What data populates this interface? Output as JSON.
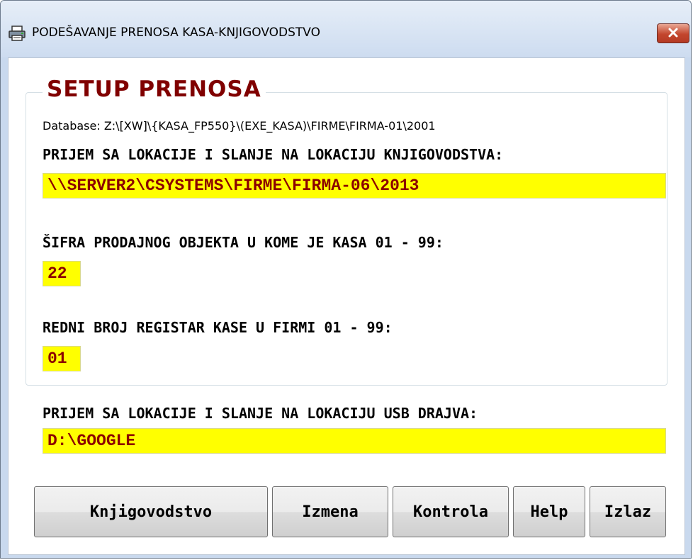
{
  "window": {
    "title": "PODEŠAVANJE PRENOSA KASA-KNJIGOVODSTVO",
    "close_label": "✕"
  },
  "setup": {
    "group_title": "SETUP PRENOSA",
    "database_line": "Database: Z:\\[XW]\\{KASA_FP550}\\(EXE_KASA)\\FIRME\\FIRMA-01\\2001",
    "accounting_location_label": "PRIJEM SA LOKACIJE I SLANJE NA LOKACIJU KNJIGOVODSTVA:",
    "accounting_location_value": "\\\\SERVER2\\CSYSTEMS\\FIRME\\FIRMA-06\\2013",
    "store_code_label": "ŠIFRA PRODAJNOG OBJEKTA U KOME JE KASA 01 - 99:",
    "store_code_value": "22",
    "register_number_label": "REDNI BROJ REGISTAR KASE U FIRMI 01 - 99:",
    "register_number_value": "01"
  },
  "usb": {
    "label": "PRIJEM SA LOKACIJE I SLANJE NA LOKACIJU USB DRAJVA:",
    "value": "D:\\GOOGLE"
  },
  "buttons": {
    "accounting": "Knjigovodstvo",
    "change": "Izmena",
    "control": "Kontrola",
    "help": "Help",
    "exit": "Izlaz"
  },
  "colors": {
    "title_accent": "#800000",
    "field_background": "#ffff00",
    "field_text": "#8b0000",
    "close_button": "#c3462d"
  },
  "icons": {
    "title": "printer-icon",
    "close": "close-icon"
  }
}
